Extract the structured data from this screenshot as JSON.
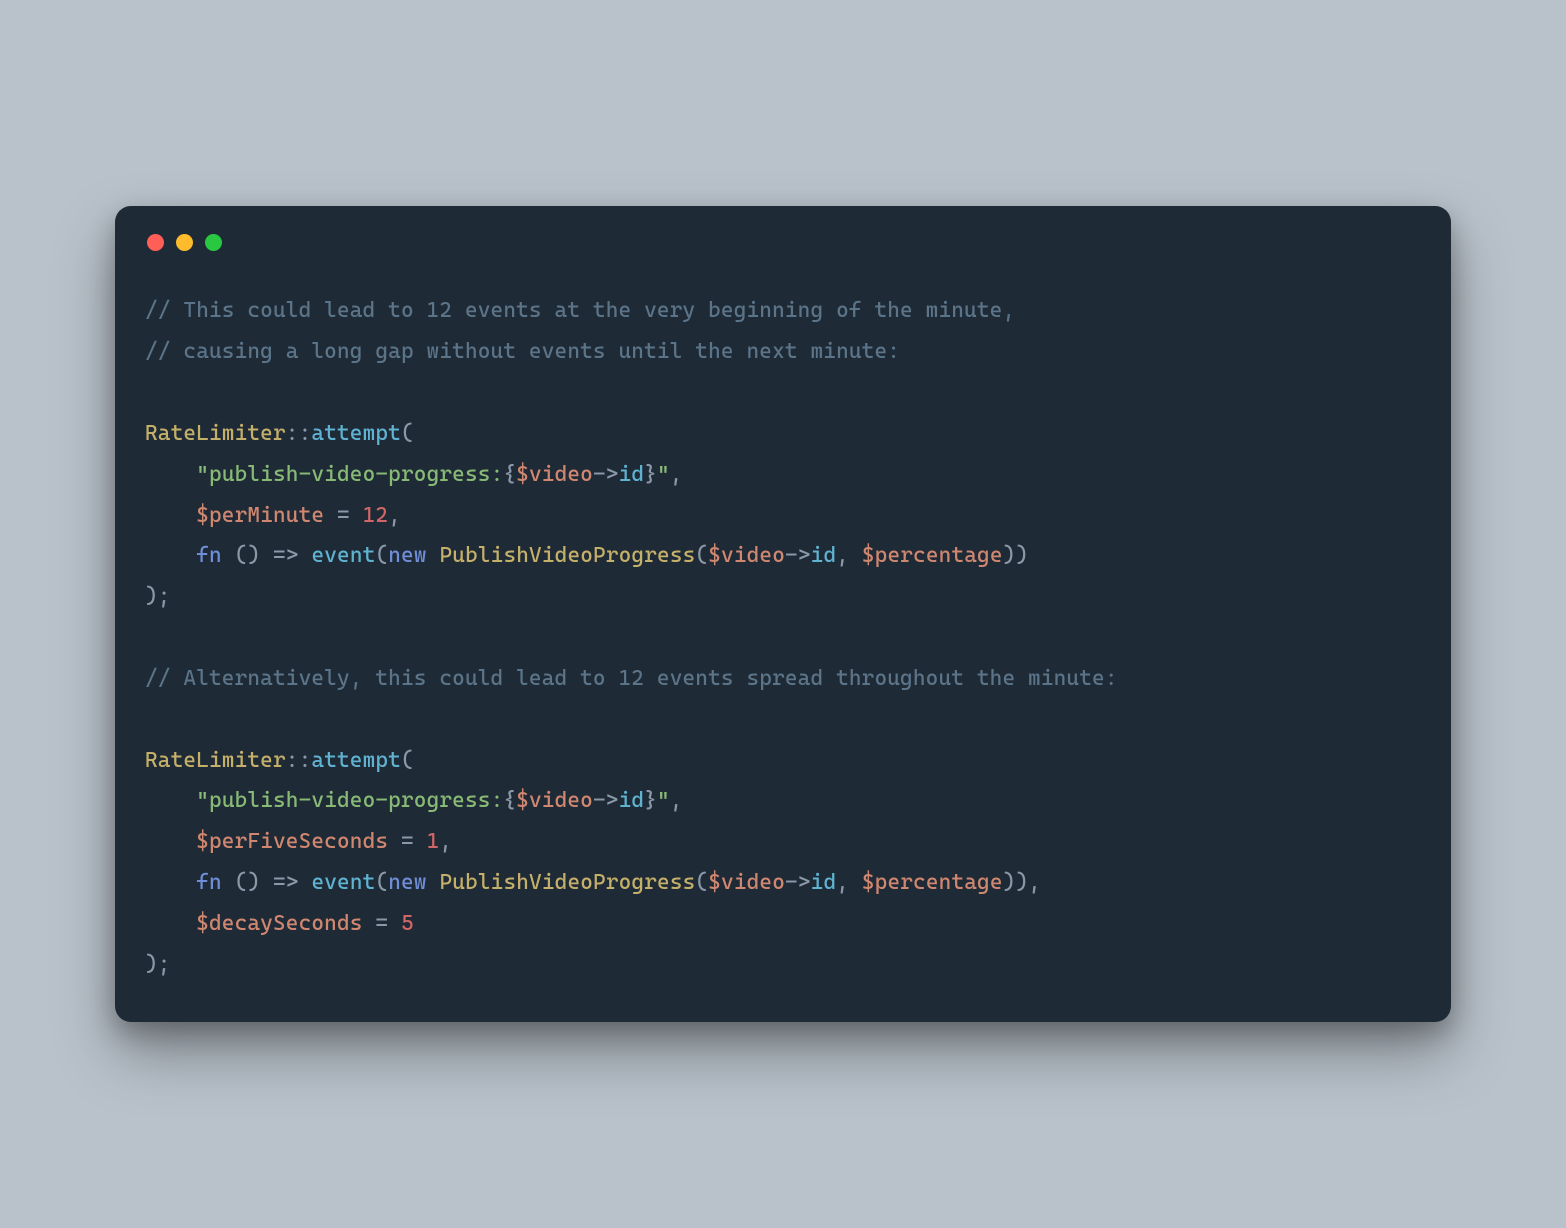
{
  "traffic_lights": {
    "red": "#ff5f57",
    "yellow": "#febb2c",
    "green": "#28c840"
  },
  "code": {
    "comment1_line1": "// This could lead to 12 events at the very beginning of the minute,",
    "comment1_line2": "// causing a long gap without events until the next minute:",
    "comment2": "// Alternatively, this could lead to 12 events spread throughout the minute:",
    "class_name": "RateLimiter",
    "double_colon": "::",
    "method": "attempt",
    "open_paren": "(",
    "close_paren": ")",
    "close_paren_semi": ");",
    "indent": "    ",
    "quote": "\"",
    "key_prefix": "publish-video-progress:",
    "interp_open": "{",
    "interp_close": "}",
    "var_video": "$video",
    "arrow_op": "->",
    "prop_id": "id",
    "comma": ",",
    "var_perMinute": "$perMinute",
    "eq": " = ",
    "val_12": "12",
    "kw_fn": "fn",
    "fn_space": " ",
    "empty_args": "()",
    "fat_arrow": " => ",
    "call_event": "event",
    "kw_new": "new",
    "class_pvp": "PublishVideoProgress",
    "var_percentage": "$percentage",
    "var_perFiveSeconds": "$perFiveSeconds",
    "val_1": "1",
    "var_decaySeconds": "$decaySeconds",
    "val_5": "5",
    "arg_sep": ", "
  }
}
